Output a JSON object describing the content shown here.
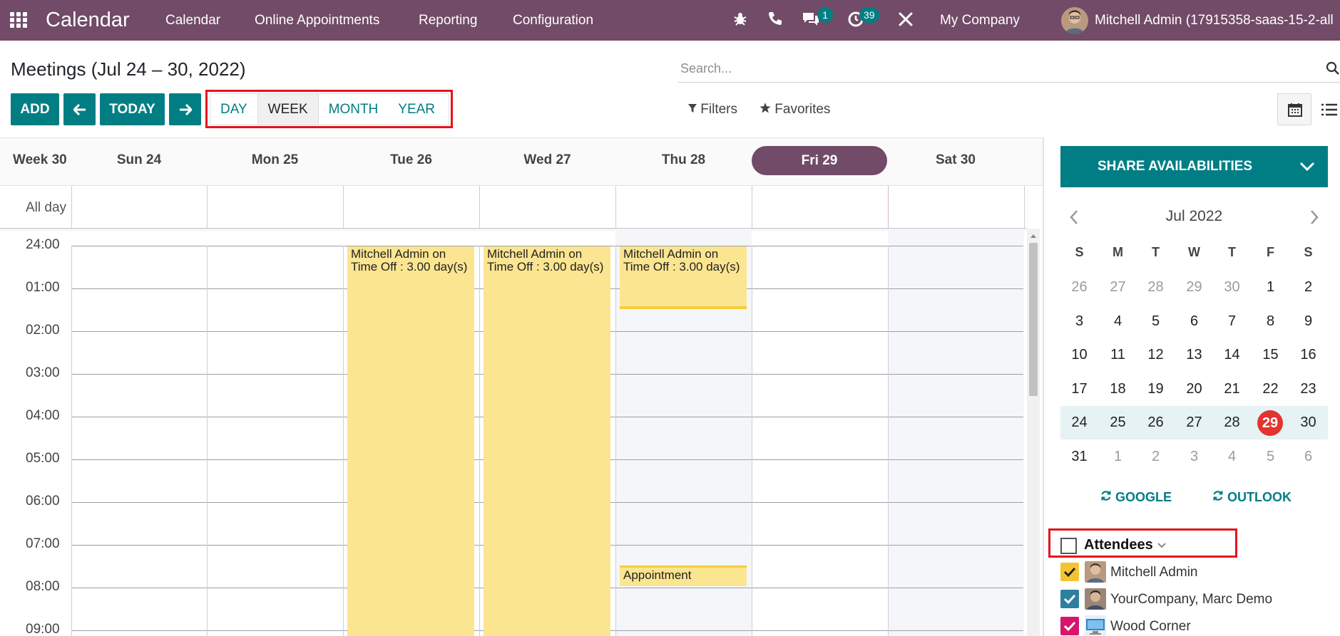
{
  "navbar": {
    "app_name": "Calendar",
    "menus": [
      "Calendar",
      "Online Appointments",
      "Reporting",
      "Configuration"
    ],
    "messages_count": "1",
    "activities_count": "39",
    "company": "My Company",
    "user": "Mitchell Admin (17915358-saas-15-2-all"
  },
  "control": {
    "title": "Meetings (Jul 24 – 30, 2022)",
    "search_placeholder": "Search...",
    "add_label": "ADD",
    "today_label": "TODAY",
    "scales": [
      "DAY",
      "WEEK",
      "MONTH",
      "YEAR"
    ],
    "active_scale": "WEEK",
    "filters_label": "Filters",
    "favorites_label": "Favorites"
  },
  "calendar": {
    "week_label": "Week 30",
    "days": [
      "Sun 24",
      "Mon 25",
      "Tue 26",
      "Wed 27",
      "Thu 28",
      "Fri 29",
      "Sat 30"
    ],
    "today": "Fri 29",
    "allday_label": "All day",
    "hours": [
      "24:00",
      "01:00",
      "02:00",
      "03:00",
      "04:00",
      "05:00",
      "06:00",
      "07:00",
      "08:00",
      "09:00"
    ],
    "events": [
      {
        "day": "Tue 26",
        "text": "Mitchell Admin on Time Off : 3.00 day(s)"
      },
      {
        "day": "Wed 27",
        "text": "Mitchell Admin on Time Off : 3.00 day(s)"
      },
      {
        "day": "Thu 28",
        "text": "Mitchell Admin on Time Off : 3.00 day(s)"
      },
      {
        "day": "Thu 28",
        "text": "Appointment"
      }
    ]
  },
  "sidebar": {
    "share_label": "SHARE AVAILABILITIES",
    "month_label": "Jul 2022",
    "weekdays": [
      "S",
      "M",
      "T",
      "W",
      "T",
      "F",
      "S"
    ],
    "weeks": [
      [
        "26",
        "27",
        "28",
        "29",
        "30",
        "1",
        "2"
      ],
      [
        "3",
        "4",
        "5",
        "6",
        "7",
        "8",
        "9"
      ],
      [
        "10",
        "11",
        "12",
        "13",
        "14",
        "15",
        "16"
      ],
      [
        "17",
        "18",
        "19",
        "20",
        "21",
        "22",
        "23"
      ],
      [
        "24",
        "25",
        "26",
        "27",
        "28",
        "29",
        "30"
      ],
      [
        "31",
        "1",
        "2",
        "3",
        "4",
        "5",
        "6"
      ]
    ],
    "today_day": "29",
    "google_label": "GOOGLE",
    "outlook_label": "OUTLOOK",
    "attendees_label": "Attendees",
    "attendees": [
      {
        "name": "Mitchell Admin",
        "color": "#f4c430"
      },
      {
        "name": "YourCompany, Marc Demo",
        "color": "#2f7fa0"
      },
      {
        "name": "Wood Corner",
        "color": "#d6166d"
      }
    ]
  },
  "colors": {
    "brand": "#714b67",
    "primary": "#017e84",
    "event": "#fbe591",
    "highlight": "#e3141b"
  }
}
